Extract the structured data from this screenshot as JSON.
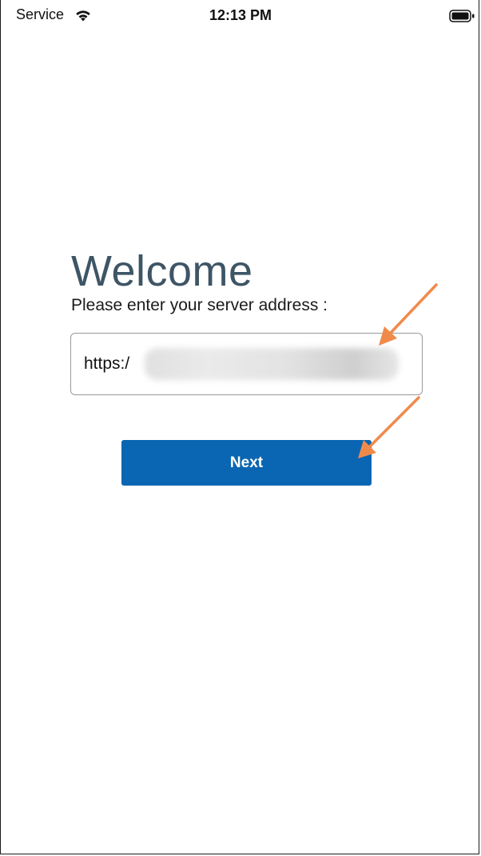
{
  "status_bar": {
    "carrier": "Service",
    "time": "12:13 PM",
    "wifi_icon": "wifi-icon",
    "battery_icon": "battery-icon"
  },
  "welcome": {
    "title": "Welcome",
    "prompt": "Please enter your server address :"
  },
  "server_field": {
    "value": "https:/",
    "redacted": true
  },
  "next_button": {
    "label": "Next"
  },
  "colors": {
    "title": "#3e5566",
    "button_background": "#0a66b2",
    "button_text": "#ffffff",
    "annotation_arrow": "#f08a4b"
  }
}
